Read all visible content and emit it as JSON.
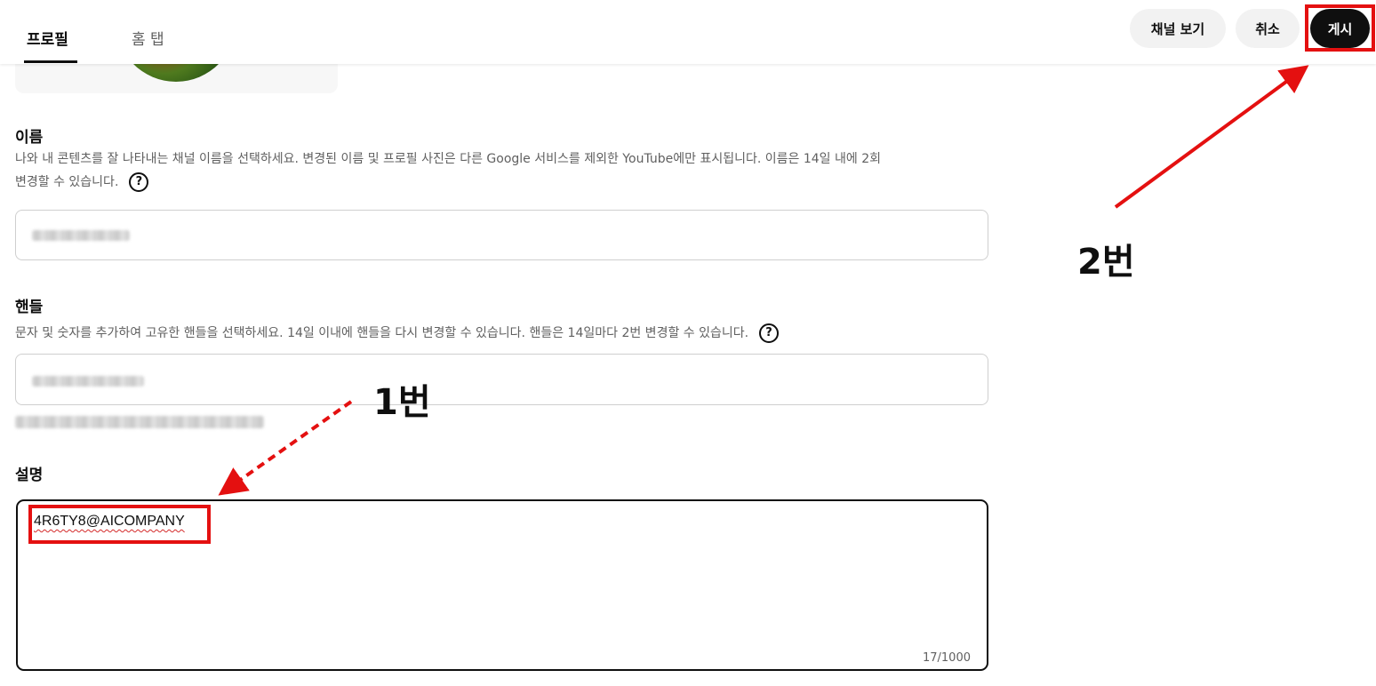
{
  "tabs": [
    {
      "label": "프로필",
      "active": true
    },
    {
      "label": "홈 탭",
      "active": false
    }
  ],
  "header_buttons": {
    "view_channel": "채널 보기",
    "cancel": "취소",
    "publish": "게시"
  },
  "name_section": {
    "label": "이름",
    "description_line1": "나와 내 콘텐츠를 잘 나타내는 채널 이름을 선택하세요. 변경된 이름 및 프로필 사진은 다른 Google 서비스를 제외한 YouTube에만 표시됩니다. 이름은 14일 내에 2회",
    "description_line2": "변경할 수 있습니다.",
    "help_icon": "?"
  },
  "handle_section": {
    "label": "핸들",
    "description": "문자 및 숫자를 추가하여 고유한 핸들을 선택하세요. 14일 이내에 핸들을 다시 변경할 수 있습니다. 핸들은 14일마다 2번 변경할 수 있습니다.",
    "help_icon": "?"
  },
  "description_section": {
    "label": "설명",
    "value": "4R6TY8@AICOMPANY",
    "counter": "17/1000"
  },
  "annotations": {
    "step1": "1번",
    "step2": "2번",
    "highlight_color": "#e41010"
  },
  "colors": {
    "publish_bg": "#0f0f0f",
    "secondary_btn_bg": "#f2f2f2",
    "muted_text": "#606060"
  }
}
